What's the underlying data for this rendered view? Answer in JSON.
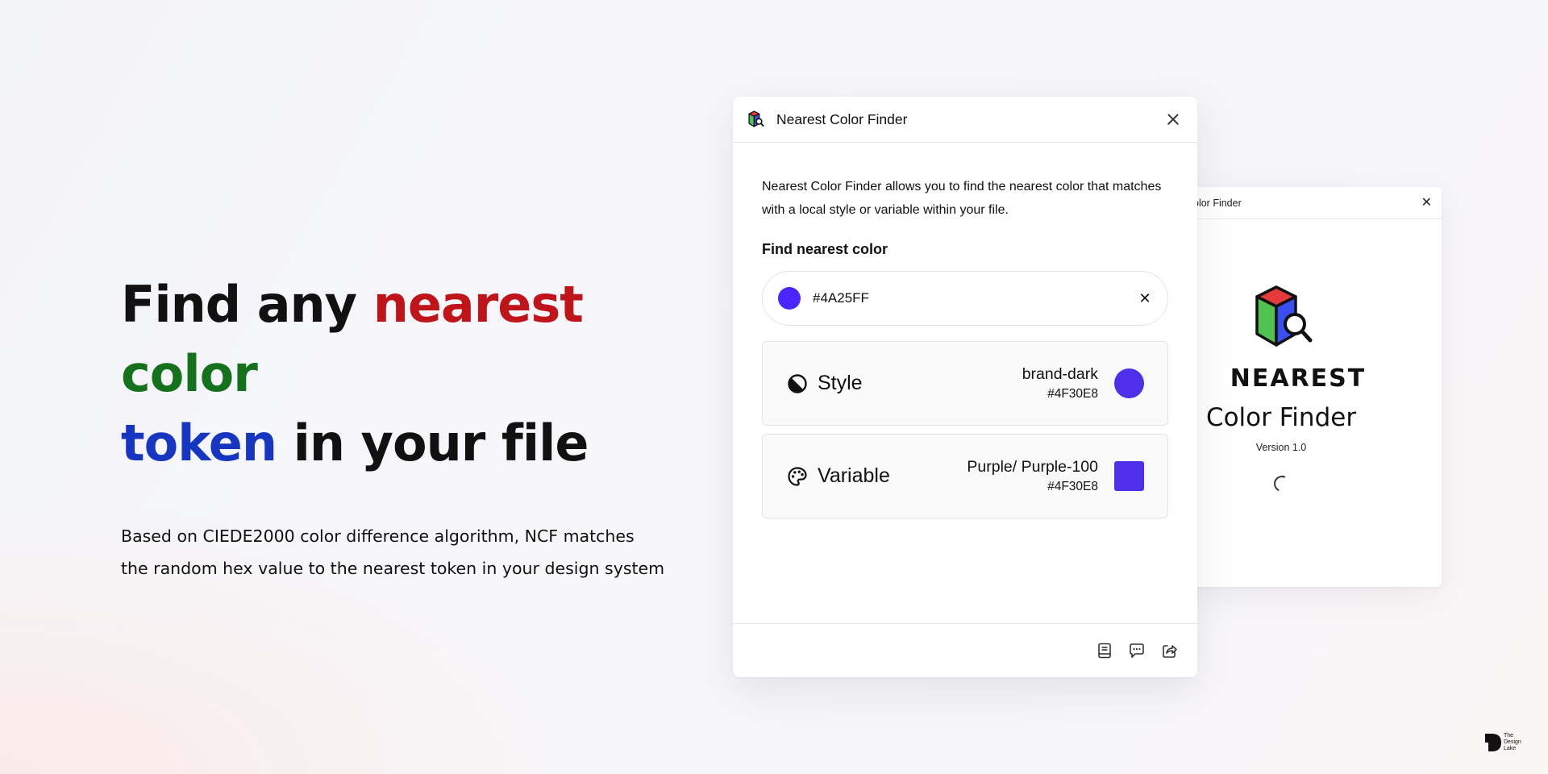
{
  "hero": {
    "headline_line1": [
      "Find any ",
      "nearest",
      " ",
      "color"
    ],
    "headline_line2": [
      "token",
      " in your file"
    ],
    "subtext_lines": [
      "Based on CIEDE2000 color difference algorithm, NCF matches",
      "the random hex value to the nearest token in your design system"
    ]
  },
  "colors": {
    "red": "#c0141b",
    "green": "#15711b",
    "blue": "#1636c2",
    "search_swatch": "#4A25FF",
    "result_swatch": "#4F30E8"
  },
  "splash": {
    "title": "olor Finder",
    "brand": "NEAREST",
    "subtitle": "Color Finder",
    "version": "Version 1.0"
  },
  "window": {
    "title": "Nearest Color Finder",
    "description": "Nearest Color Finder allows you to find the nearest color that matches with a local style or variable within your file.",
    "section_label": "Find nearest color",
    "search": {
      "value": "#4A25FF",
      "clear_label": "✕"
    },
    "results": [
      {
        "icon": "contrast-icon",
        "type": "Style",
        "name": "brand-dark",
        "hex": "#4F30E8",
        "swatch_shape": "circle"
      },
      {
        "icon": "palette-icon",
        "type": "Variable",
        "name": "Purple/ Purple-100",
        "hex": "#4F30E8",
        "swatch_shape": "square"
      }
    ],
    "footer_icons": [
      "book-icon",
      "chat-icon",
      "share-icon"
    ]
  },
  "watermark": {
    "lines": [
      "The",
      "Design",
      "Lake"
    ]
  }
}
